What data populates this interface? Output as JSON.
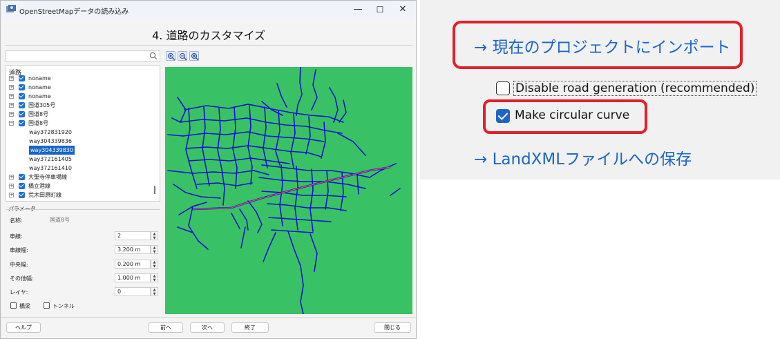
{
  "window": {
    "title": "OpenStreetMapデータの読み込み",
    "minimize": "—",
    "maximize": "☐",
    "close": "✕"
  },
  "heading": "4. 道路のカスタマイズ",
  "search": {
    "value": "",
    "placeholder": ""
  },
  "tree": {
    "root": "道路",
    "items": [
      {
        "label": "noname",
        "expander": "+",
        "checked": true
      },
      {
        "label": "noname",
        "expander": "+",
        "checked": true
      },
      {
        "label": "noname",
        "expander": "+",
        "checked": true
      },
      {
        "label": "国道305号",
        "expander": "+",
        "checked": true
      },
      {
        "label": "国道8号",
        "expander": "+",
        "checked": true
      },
      {
        "label": "国道8号",
        "expander": "−",
        "checked": true
      },
      {
        "label": "way372831920"
      },
      {
        "label": "way304339836"
      },
      {
        "label": "way304339830",
        "selected": true
      },
      {
        "label": "way372161405"
      },
      {
        "label": "way372161410"
      },
      {
        "label": "大聖寺停車場線",
        "expander": "+",
        "checked": true
      },
      {
        "label": "橋立港線",
        "expander": "+",
        "checked": true
      },
      {
        "label": "荒木田原町線",
        "expander": "+",
        "checked": true
      }
    ]
  },
  "params": {
    "legend": "パラメータ",
    "name_label": "名称:",
    "name_value": "国道8号",
    "rows": [
      {
        "label": "車線:",
        "value": "2"
      },
      {
        "label": "車線幅:",
        "value": "3.200 m"
      },
      {
        "label": "中央幅:",
        "value": "0.200 m"
      },
      {
        "label": "その他幅:",
        "value": "1.000 m"
      },
      {
        "label": "レイヤ:",
        "value": "0"
      }
    ],
    "bridge": "橋梁",
    "tunnel": "トンネル"
  },
  "buttons": {
    "help": "ヘルプ",
    "prev": "前へ",
    "next": "次へ",
    "finish": "終了",
    "close": "閉じる"
  },
  "zoom_panel": {
    "import_link": "→ 現在のプロジェクトにインポート",
    "disable_road": "Disable road generation (recommended)",
    "circular_curve": "Make circular curve",
    "landxml_link": "→ LandXMLファイルへの保存"
  },
  "colors": {
    "map_background": "#38c265",
    "road": "#1010cc",
    "selected_road": "#e8506a",
    "highlight_ring": "#e0212b",
    "link": "#1a66c9",
    "checkbox": "#1f66c4"
  }
}
